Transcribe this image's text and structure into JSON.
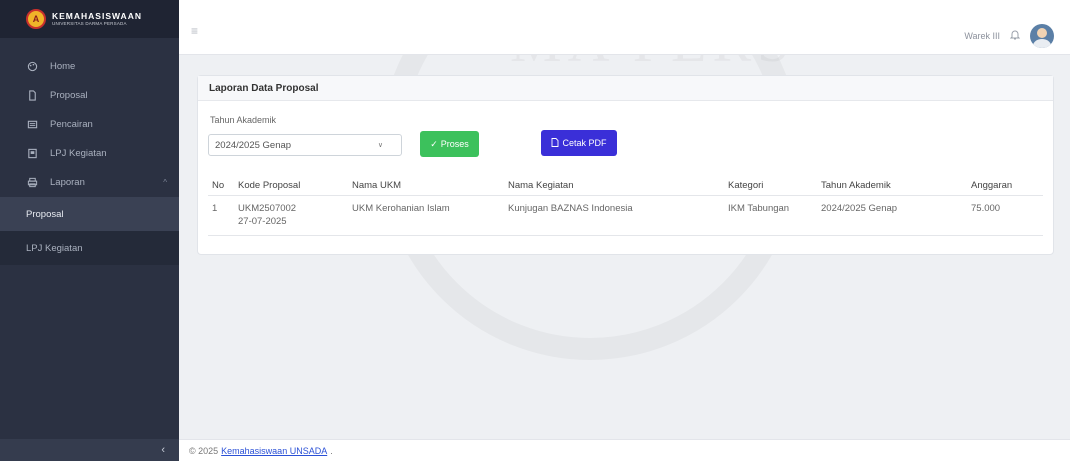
{
  "brand": {
    "title": "KEMAHASISWAAN",
    "subtitle": "UNIVERSITAS DARMA PERSADA",
    "logo_letter": "A"
  },
  "sidebar": {
    "items": [
      {
        "label": "Home",
        "icon": "palette-icon"
      },
      {
        "label": "Proposal",
        "icon": "file-icon"
      },
      {
        "label": "Pencairan",
        "icon": "wallet-icon"
      },
      {
        "label": "LPJ Kegiatan",
        "icon": "clipboard-icon"
      },
      {
        "label": "Laporan",
        "icon": "printer-icon"
      }
    ],
    "submenu": [
      {
        "label": "Proposal"
      },
      {
        "label": "LPJ Kegiatan"
      }
    ]
  },
  "header": {
    "username": "Warek III"
  },
  "card": {
    "title": "Laporan Data Proposal",
    "form": {
      "label": "Tahun Akademik",
      "selected": "2024/2025 Genap",
      "proses_label": "Proses",
      "pdf_label": "Cetak PDF"
    },
    "table": {
      "headers": [
        "No",
        "Kode Proposal",
        "Nama UKM",
        "Nama Kegiatan",
        "Kategori",
        "Tahun Akademik",
        "Anggaran"
      ],
      "rows": [
        {
          "no": "1",
          "kode": "UKM2507002",
          "tanggal": "27-07-2025",
          "ukm": "UKM Kerohanian Islam",
          "kegiatan": "Kunjugan BAZNAS Indonesia",
          "kategori": "IKM Tabungan",
          "tahun": "2024/2025 Genap",
          "anggaran": "75.000"
        }
      ]
    }
  },
  "footer": {
    "prefix": "© 2025",
    "link": "Kemahasiswaan UNSADA",
    "suffix": "."
  },
  "watermark": "MA PERS"
}
